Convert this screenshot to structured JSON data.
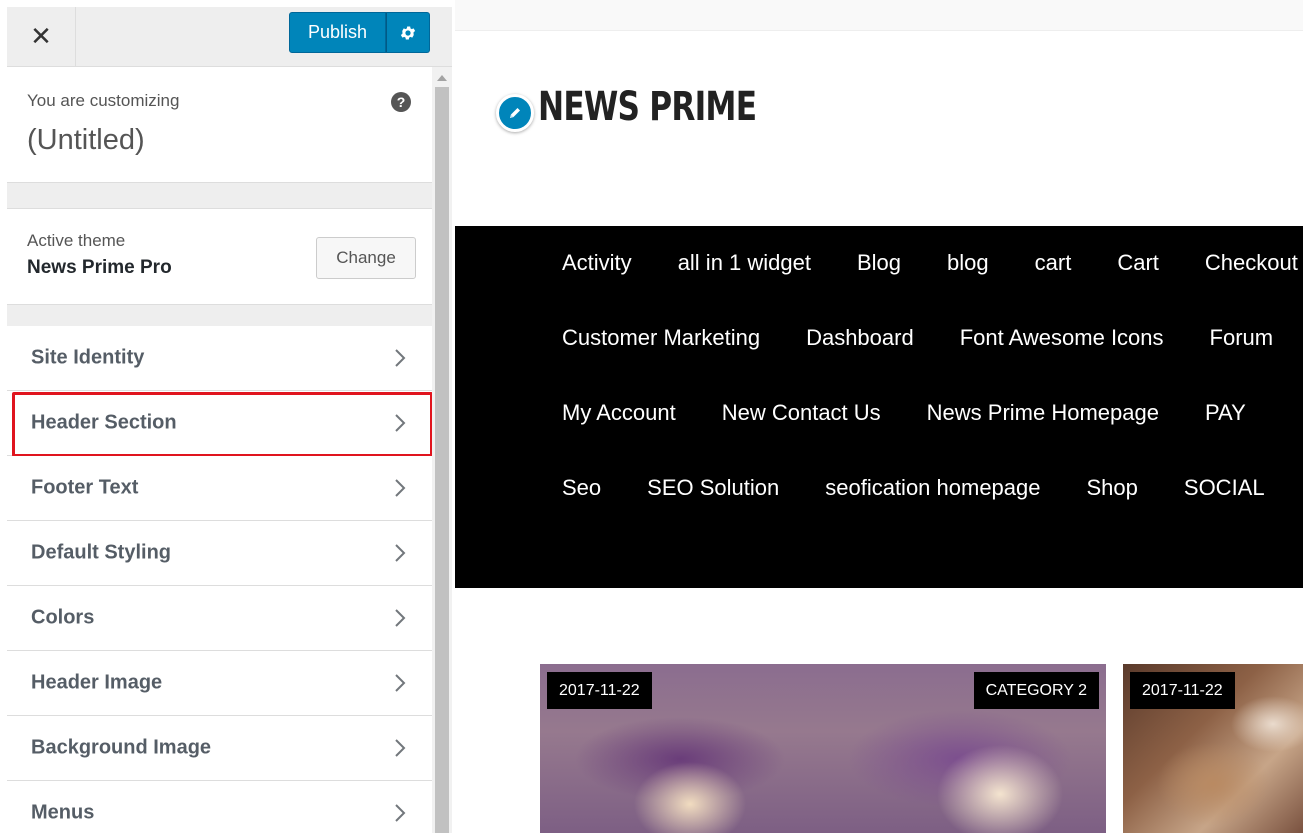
{
  "toolbar": {
    "close_glyph": "✕",
    "publish_label": "Publish"
  },
  "customizing": {
    "label": "You are customizing",
    "title": "(Untitled)",
    "help_glyph": "?"
  },
  "theme": {
    "label": "Active theme",
    "name": "News Prime Pro",
    "change_label": "Change"
  },
  "sections": [
    {
      "label": "Site Identity"
    },
    {
      "label": "Header Section",
      "highlighted": true
    },
    {
      "label": "Footer Text"
    },
    {
      "label": "Default Styling"
    },
    {
      "label": "Colors"
    },
    {
      "label": "Header Image"
    },
    {
      "label": "Background Image"
    },
    {
      "label": "Menus"
    }
  ],
  "preview": {
    "site_title": "NEWS PRIME",
    "nav_rows": [
      [
        "Activity",
        "all in 1 widget",
        "Blog",
        "blog",
        "cart",
        "Cart",
        "Checkout"
      ],
      [
        "Customer Marketing",
        "Dashboard",
        "Font Awesome Icons",
        "Forum"
      ],
      [
        "My Account",
        "New Contact Us",
        "News Prime Homepage",
        "PAY"
      ],
      [
        "Seo",
        "SEO Solution",
        "seofication homepage",
        "Shop",
        "SOCIAL"
      ]
    ],
    "posts": [
      {
        "date": "2017-11-22",
        "category": "CATEGORY 2"
      },
      {
        "date": "2017-11-22"
      }
    ]
  },
  "colors": {
    "accent": "#0085ba",
    "highlight_border": "#e0141e",
    "navbar_bg": "#000000"
  }
}
